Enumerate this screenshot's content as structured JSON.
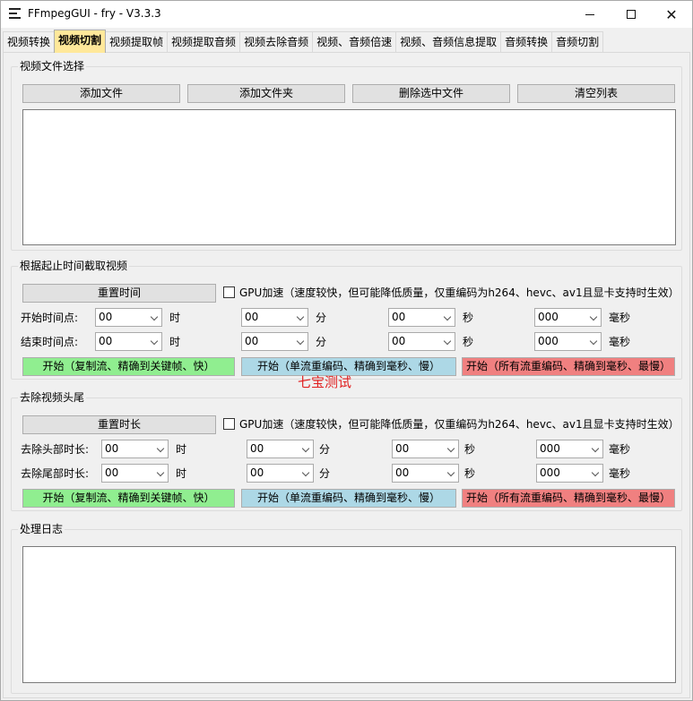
{
  "window": {
    "title": "FFmpegGUI - fry - V3.3.3",
    "minimize_icon": "minimize-icon",
    "maximize_icon": "maximize-icon",
    "close_icon": "close-icon",
    "close_glyph": "✕"
  },
  "tabs": [
    {
      "label": "视频转换"
    },
    {
      "label": "视频切割",
      "active": true
    },
    {
      "label": "视频提取帧"
    },
    {
      "label": "视频提取音频"
    },
    {
      "label": "视频去除音频"
    },
    {
      "label": "视频、音频倍速"
    },
    {
      "label": "视频、音频信息提取"
    },
    {
      "label": "音频转换"
    },
    {
      "label": "音频切割"
    }
  ],
  "file_group": {
    "title": "视频文件选择",
    "add_file": "添加文件",
    "add_folder": "添加文件夹",
    "delete_selected": "删除选中文件",
    "clear_list": "清空列表"
  },
  "cut_group": {
    "title": "根据起止时间截取视频",
    "reset_button": "重置时间",
    "gpu_label": "GPU加速（速度较快，但可能降低质量，仅重编码为h264、hevc、av1且显卡支持时生效）",
    "start_label": "开始时间点:",
    "end_label": "结束时间点:",
    "start": {
      "h": "00",
      "m": "00",
      "s": "00",
      "ms": "000"
    },
    "end": {
      "h": "00",
      "m": "00",
      "s": "00",
      "ms": "000"
    },
    "unit_h": "时",
    "unit_m": "分",
    "unit_s": "秒",
    "unit_ms": "毫秒",
    "btn_copy": "开始（复制流、精确到关键帧、快）",
    "btn_single": "开始（单流重编码、精确到毫秒、慢）",
    "btn_all": "开始（所有流重编码、精确到毫秒、最慢）"
  },
  "watermark": "七宝测试",
  "trim_group": {
    "title": "去除视频头尾",
    "reset_button": "重置时长",
    "gpu_label": "GPU加速（速度较快，但可能降低质量，仅重编码为h264、hevc、av1且显卡支持时生效）",
    "head_label": "去除头部时长:",
    "tail_label": "去除尾部时长:",
    "head": {
      "h": "00",
      "m": "00",
      "s": "00",
      "ms": "000"
    },
    "tail": {
      "h": "00",
      "m": "00",
      "s": "00",
      "ms": "000"
    },
    "unit_h": "时",
    "unit_m": "分",
    "unit_s": "秒",
    "unit_ms": "毫秒",
    "btn_copy": "开始（复制流、精确到关键帧、快）",
    "btn_single": "开始（单流重编码、精确到毫秒、慢）",
    "btn_all": "开始（所有流重编码、精确到毫秒、最慢）"
  },
  "log_group": {
    "title": "处理日志"
  },
  "colors": {
    "active_tab": "#ffe89a",
    "green_button": "#90ee90",
    "blue_button": "#add8e6",
    "red_button": "#f08080",
    "watermark": "#e02020"
  }
}
